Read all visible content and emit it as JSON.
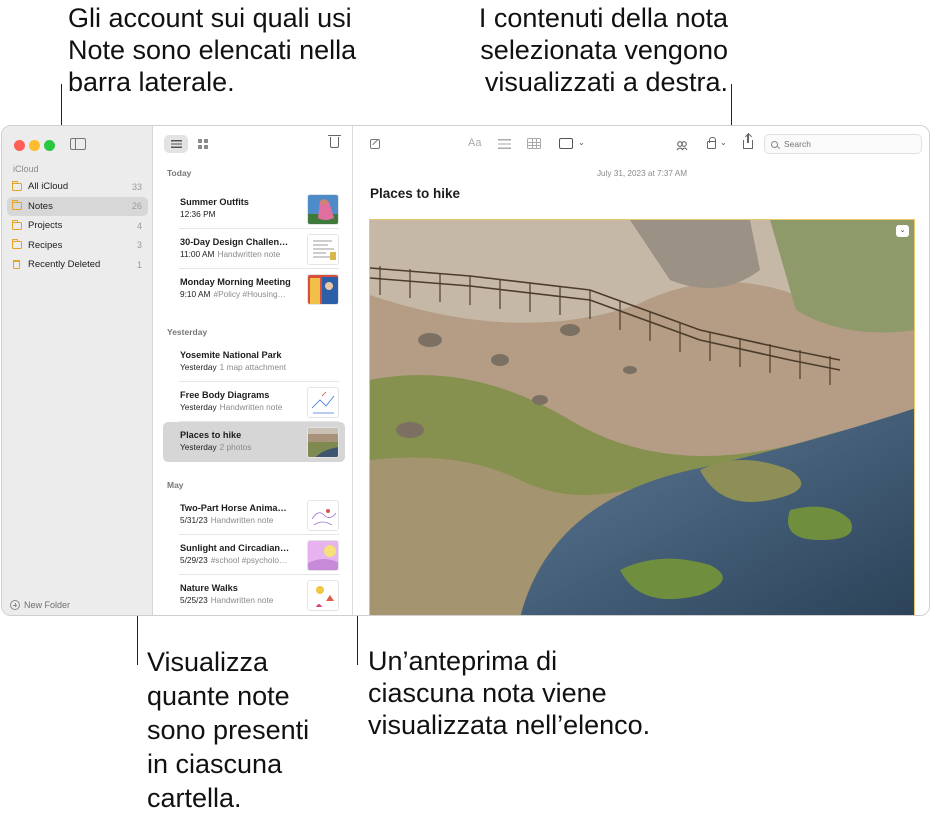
{
  "callouts": {
    "sidebar": "Gli account sui quali usi\nNote sono elencati nella\nbarra laterale.",
    "content": "I contenuti della nota\nselezionata vengono\nvisualizzati a destra.",
    "counts": "Visualizza\nquante note\nsono presenti\nin ciascuna\ncartella.",
    "preview": "Un’anteprima di\nciascuna nota viene\nvisualizzata nell’elenco."
  },
  "sidebar": {
    "account": "iCloud",
    "folders": [
      {
        "label": "All iCloud",
        "count": "33"
      },
      {
        "label": "Notes",
        "count": "26",
        "selected": true
      },
      {
        "label": "Projects",
        "count": "4"
      },
      {
        "label": "Recipes",
        "count": "3"
      },
      {
        "label": "Recently Deleted",
        "count": "1"
      }
    ],
    "new_folder": "New Folder"
  },
  "note_list": {
    "sections": [
      "Today",
      "Yesterday",
      "May"
    ],
    "notes": [
      {
        "title": "Summer Outfits",
        "time": "12:36 PM",
        "detail": ""
      },
      {
        "title": "30-Day Design Challen…",
        "time": "11:00 AM",
        "detail": "Handwritten note"
      },
      {
        "title": "Monday Morning Meeting",
        "time": "9:10 AM",
        "detail": "#Policy #Housing…"
      },
      {
        "title": "Yosemite National Park",
        "time": "Yesterday",
        "detail": "1 map attachment"
      },
      {
        "title": "Free Body Diagrams",
        "time": "Yesterday",
        "detail": "Handwritten note"
      },
      {
        "title": "Places to hike",
        "time": "Yesterday",
        "detail": "2 photos"
      },
      {
        "title": "Two-Part Horse Anima…",
        "time": "5/31/23",
        "detail": "Handwritten note"
      },
      {
        "title": "Sunlight and Circadian…",
        "time": "5/29/23",
        "detail": "#school #psycholo…"
      },
      {
        "title": "Nature Walks",
        "time": "5/25/23",
        "detail": "Handwritten note"
      }
    ]
  },
  "toolbar": {
    "text_format_label": "Aa",
    "search_placeholder": "Search",
    "icons": [
      "compose-icon",
      "text-format-icon",
      "checklist-icon",
      "table-icon",
      "media-icon",
      "collaborate-icon",
      "lock-icon",
      "share-icon",
      "search-icon",
      "trash-icon",
      "list-view-icon",
      "gallery-view-icon",
      "sidebar-toggle-icon"
    ]
  },
  "note": {
    "date": "July 31, 2023 at 7:37 AM",
    "title": "Places to hike"
  },
  "colors": {
    "accent_folder": "#e5a524",
    "sidebar_bg": "#ececec",
    "selection": "#d6d6d6"
  }
}
